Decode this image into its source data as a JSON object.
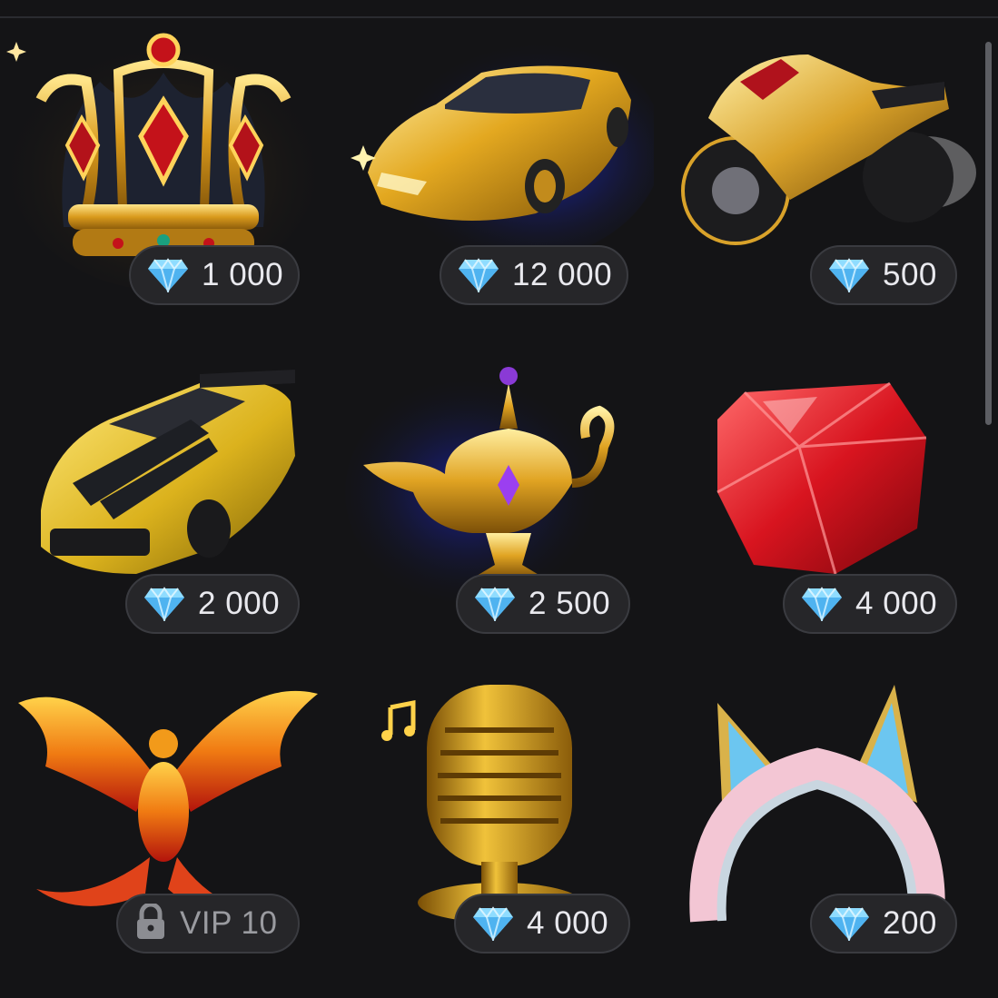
{
  "gifts": [
    {
      "name": "crown-icon",
      "price": "1 000",
      "locked": false
    },
    {
      "name": "gold-sports-car-icon",
      "price": "12 000",
      "locked": false
    },
    {
      "name": "gold-motorcycle-icon",
      "price": "500",
      "locked": false
    },
    {
      "name": "gold-muscle-car-icon",
      "price": "2 000",
      "locked": false
    },
    {
      "name": "magic-lamp-icon",
      "price": "2 500",
      "locked": false
    },
    {
      "name": "ruby-icon",
      "price": "4 000",
      "locked": false
    },
    {
      "name": "phoenix-icon",
      "price": "VIP 10",
      "locked": true
    },
    {
      "name": "gold-microphone-icon",
      "price": "4 000",
      "locked": false
    },
    {
      "name": "cat-ear-headband-icon",
      "price": "200",
      "locked": false
    }
  ],
  "icons": {
    "currency": "diamond-icon",
    "lock": "lock-icon"
  },
  "colors": {
    "background": "#141416",
    "pill": "#262629",
    "pill_border": "#3a3b40",
    "gem": "#7fd3ff",
    "gold": "#e5b53a"
  }
}
